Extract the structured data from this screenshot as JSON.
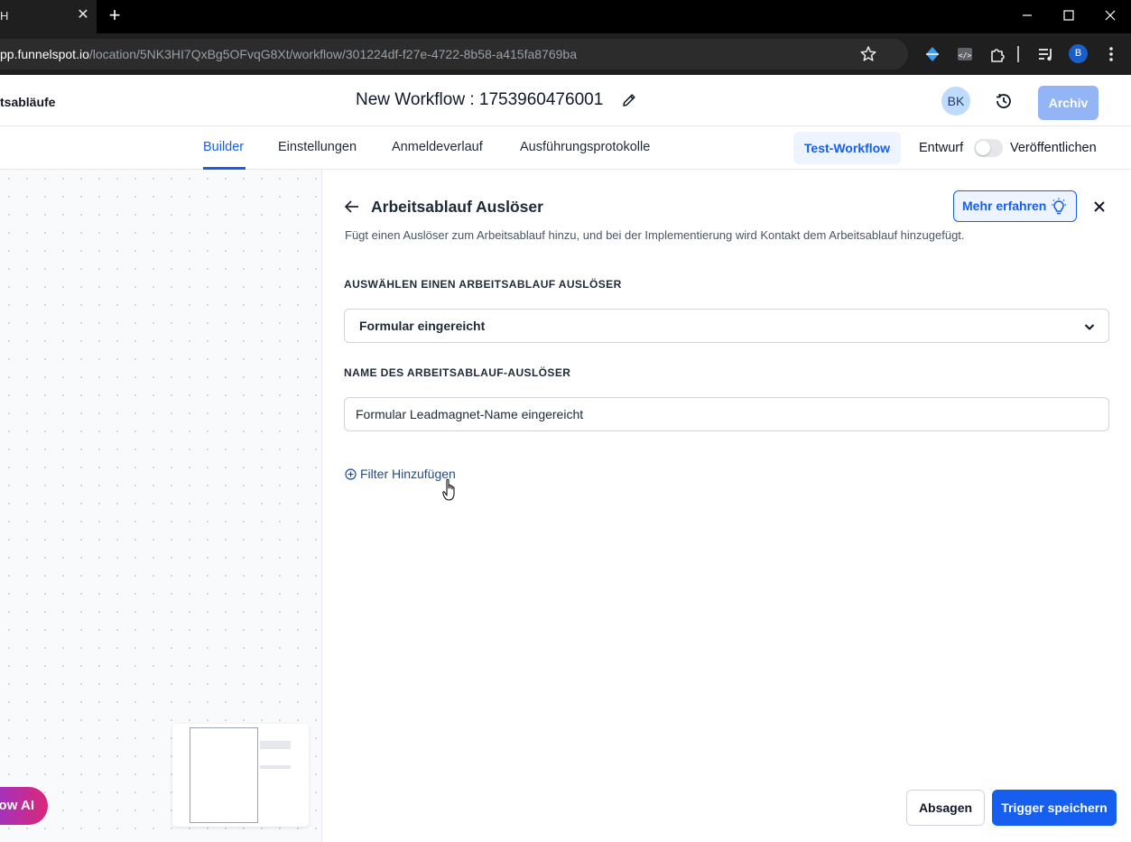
{
  "browser": {
    "tab_title": "H",
    "url_host": "pp.funnelspot.io",
    "url_path": "/location/5NK3HI7QxBg5OFvqG8Xt/workflow/301224df-f27e-4722-8b58-a415fa8769ba",
    "profile_initial": "B"
  },
  "header": {
    "breadcrumb": "tsabläufe",
    "workflow_title": "New Workflow : 1753960476001",
    "avatar_initials": "BK",
    "archive_label": "Archiv"
  },
  "nav": {
    "tabs": [
      {
        "label": "Builder",
        "active": true
      },
      {
        "label": "Einstellungen",
        "active": false
      },
      {
        "label": "Anmeldeverlauf",
        "active": false
      },
      {
        "label": "Ausführungsprotokolle",
        "active": false
      }
    ],
    "test_label": "Test-Workflow",
    "draft_label": "Entwurf",
    "publish_label": "Veröffentlichen",
    "published": false
  },
  "canvas": {
    "ai_button_label": "ow AI"
  },
  "panel": {
    "title": "Arbeitsablauf Auslöser",
    "learn_more_label": "Mehr erfahren",
    "description": "Fügt einen Auslöser zum Arbeitsablauf hinzu, und bei der Implementierung wird Kontakt dem Arbeitsablauf hinzugefügt.",
    "trigger_select_label": "AUSWÄHLEN EINEN ARBEITSABLAUF AUSLÖSER",
    "trigger_select_value": "Formular eingereicht",
    "trigger_name_label": "NAME DES ARBEITSABLAUF-AUSLÖSER",
    "trigger_name_value": "Formular Leadmagnet-Name eingereicht",
    "add_filter_label": "Filter Hinzufügen",
    "cancel_label": "Absagen",
    "save_label": "Trigger speichern"
  },
  "colors": {
    "primary": "#155eef",
    "primary_light": "#eef4ff",
    "archive_disabled": "#93b4f5"
  }
}
